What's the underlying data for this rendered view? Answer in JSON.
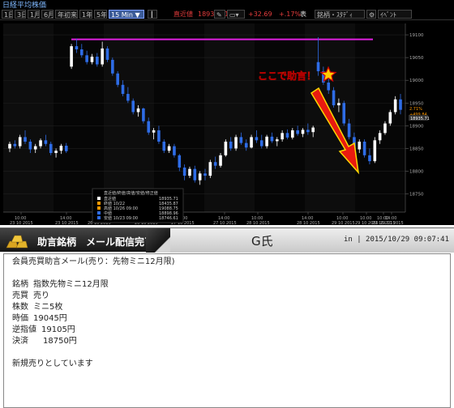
{
  "window": {
    "title": "日経平均株価"
  },
  "toolbar": {
    "buttons": [
      "1日",
      "3日",
      "1月",
      "6月",
      "年初来",
      "1年",
      "5年"
    ],
    "interval": "15 Min",
    "latest_label": "直近値",
    "latest_value": "18935.71",
    "change": "+32.69",
    "change_pct": "+.17%",
    "indicator_label": "銘柄・ｽﾀﾃﾞｨ",
    "event_label": "ｲﾍﾞﾝﾄ",
    "table_label": "表"
  },
  "chart_data": {
    "type": "candlestick",
    "y_ticks": [
      19100,
      19050,
      19000,
      18950,
      18900,
      18850,
      18800,
      18750
    ],
    "ylim": [
      18710,
      19125
    ],
    "x_ticks": [
      [
        "10:00",
        "23 10 2015"
      ],
      [
        "14:00",
        "23 10 2015"
      ],
      [
        "10:00",
        "26 10 2015"
      ],
      [
        "14:00",
        "26 10 2015"
      ],
      [
        "10:00",
        "27 10 2015"
      ],
      [
        "14:00",
        "27 10 2015"
      ],
      [
        "10:00",
        "28 10 2015"
      ],
      [
        "14:00",
        "28 10 2015"
      ],
      [
        "10:00",
        "29 10 2015"
      ],
      [
        "10:00",
        "29 10 2015"
      ],
      [
        "10:00",
        "29 10 2015"
      ],
      [
        "14:00",
        "29 10 2015"
      ]
    ],
    "resistance_line": 19090,
    "candles": [
      [
        18850,
        18865,
        18842,
        18860
      ],
      [
        18860,
        18868,
        18850,
        18855
      ],
      [
        18855,
        18880,
        18850,
        18875
      ],
      [
        18875,
        18890,
        18860,
        18865
      ],
      [
        18865,
        18870,
        18840,
        18848
      ],
      [
        18848,
        18860,
        18840,
        18855
      ],
      [
        18855,
        18872,
        18850,
        18868
      ],
      [
        18868,
        18880,
        18855,
        18860
      ],
      [
        18860,
        18865,
        18835,
        18840
      ],
      [
        18840,
        18850,
        18830,
        18845
      ],
      [
        18845,
        18860,
        18838,
        18856
      ],
      [
        18856,
        18862,
        18840,
        18844
      ],
      [
        19030,
        19080,
        19025,
        19075
      ],
      [
        19075,
        19092,
        19060,
        19068
      ],
      [
        19068,
        19080,
        19050,
        19055
      ],
      [
        19055,
        19065,
        19035,
        19040
      ],
      [
        19040,
        19058,
        19035,
        19052
      ],
      [
        19052,
        19060,
        19030,
        19035
      ],
      [
        19035,
        19085,
        19030,
        19070
      ],
      [
        19070,
        19075,
        19040,
        19045
      ],
      [
        19045,
        19050,
        19010,
        19015
      ],
      [
        19015,
        19020,
        18985,
        18990
      ],
      [
        18990,
        19000,
        18965,
        18970
      ],
      [
        18970,
        18985,
        18950,
        18955
      ],
      [
        18955,
        18960,
        18925,
        18930
      ],
      [
        18930,
        18945,
        18920,
        18938
      ],
      [
        18938,
        18940,
        18905,
        18910
      ],
      [
        18910,
        18918,
        18880,
        18885
      ],
      [
        18885,
        18895,
        18870,
        18890
      ],
      [
        18890,
        18900,
        18860,
        18865
      ],
      [
        18865,
        18870,
        18840,
        18845
      ],
      [
        18845,
        18860,
        18840,
        18855
      ],
      [
        18855,
        18860,
        18830,
        18835
      ],
      [
        18835,
        18838,
        18800,
        18808
      ],
      [
        18808,
        18815,
        18780,
        18790
      ],
      [
        18790,
        18810,
        18785,
        18805
      ],
      [
        18805,
        18812,
        18775,
        18780
      ],
      [
        18780,
        18800,
        18770,
        18795
      ],
      [
        18795,
        18805,
        18780,
        18790
      ],
      [
        18790,
        18825,
        18785,
        18820
      ],
      [
        18820,
        18832,
        18805,
        18812
      ],
      [
        18812,
        18840,
        18808,
        18835
      ],
      [
        18835,
        18870,
        18832,
        18865
      ],
      [
        18865,
        18875,
        18845,
        18850
      ],
      [
        18850,
        18880,
        18845,
        18875
      ],
      [
        18875,
        18885,
        18858,
        18862
      ],
      [
        18862,
        18870,
        18845,
        18852
      ],
      [
        18852,
        18880,
        18850,
        18875
      ],
      [
        18875,
        18890,
        18862,
        18868
      ],
      [
        18868,
        18880,
        18850,
        18855
      ],
      [
        18855,
        18880,
        18850,
        18876
      ],
      [
        18876,
        18885,
        18862,
        18866
      ],
      [
        18866,
        18875,
        18855,
        18870
      ],
      [
        18870,
        18890,
        18865,
        18884
      ],
      [
        18884,
        18892,
        18870,
        18874
      ],
      [
        18874,
        18895,
        18870,
        18890
      ],
      [
        18890,
        18900,
        18878,
        18882
      ],
      [
        18882,
        18895,
        18875,
        18891
      ],
      [
        18891,
        18905,
        18880,
        18886
      ],
      [
        18886,
        18900,
        18875,
        18896
      ],
      [
        19040,
        19095,
        19010,
        19020
      ],
      [
        19020,
        19030,
        18990,
        18995
      ],
      [
        18995,
        19005,
        18970,
        18978
      ],
      [
        18978,
        18985,
        18940,
        18945
      ],
      [
        18945,
        18960,
        18930,
        18950
      ],
      [
        18950,
        18955,
        18900,
        18905
      ],
      [
        18905,
        18915,
        18870,
        18875
      ],
      [
        18875,
        18885,
        18840,
        18848
      ],
      [
        18848,
        18870,
        18840,
        18865
      ],
      [
        18865,
        18870,
        18830,
        18835
      ],
      [
        18835,
        18850,
        18815,
        18822
      ],
      [
        18822,
        18875,
        18818,
        18868
      ],
      [
        18868,
        18890,
        18860,
        18884
      ],
      [
        18884,
        18910,
        18880,
        18905
      ],
      [
        18905,
        18935,
        18900,
        18930
      ],
      [
        18930,
        18965,
        18925,
        18958
      ],
      [
        18958,
        18970,
        18925,
        18935
      ]
    ],
    "last_value": "18935.71",
    "label_right": "2.71%",
    "label_right_2": "+499.84",
    "legend": {
      "header": "直近値/終値/高値/安値/修正値",
      "rows": [
        [
          "直近値",
          "18935.71"
        ],
        [
          "終値 10/22",
          "18435.87"
        ],
        [
          "高値 10/26 09:00",
          "19088.75"
        ],
        [
          "中値",
          "18898.96"
        ],
        [
          "安値 10/23 09:00",
          "18746.61"
        ]
      ]
    },
    "annotation": "ここで助言！"
  },
  "message": {
    "header_title": "助言銘柄　メール配信完了",
    "author": "G氏",
    "timestamp": "in | 2015/10/29 09:07:41",
    "subject": "会員売買助言メール(売り：先物ミニ12月限)",
    "fields": [
      [
        "銘柄",
        "指数先物ミニ12月限"
      ],
      [
        "売買",
        "売り"
      ],
      [
        "株数",
        "ミニ5枚"
      ],
      [
        "時価",
        "19045円"
      ],
      [
        "逆指値",
        "19105円"
      ],
      [
        "決済",
        "18750円"
      ]
    ],
    "footer": "新規売りとしています"
  },
  "colors": {
    "bull": "#ffffff",
    "bear": "#2e6ce6",
    "resistance": "#e020e0",
    "arrow": "#e81a10",
    "annotation_text": "#ffff00",
    "star": "#ffcc00"
  }
}
